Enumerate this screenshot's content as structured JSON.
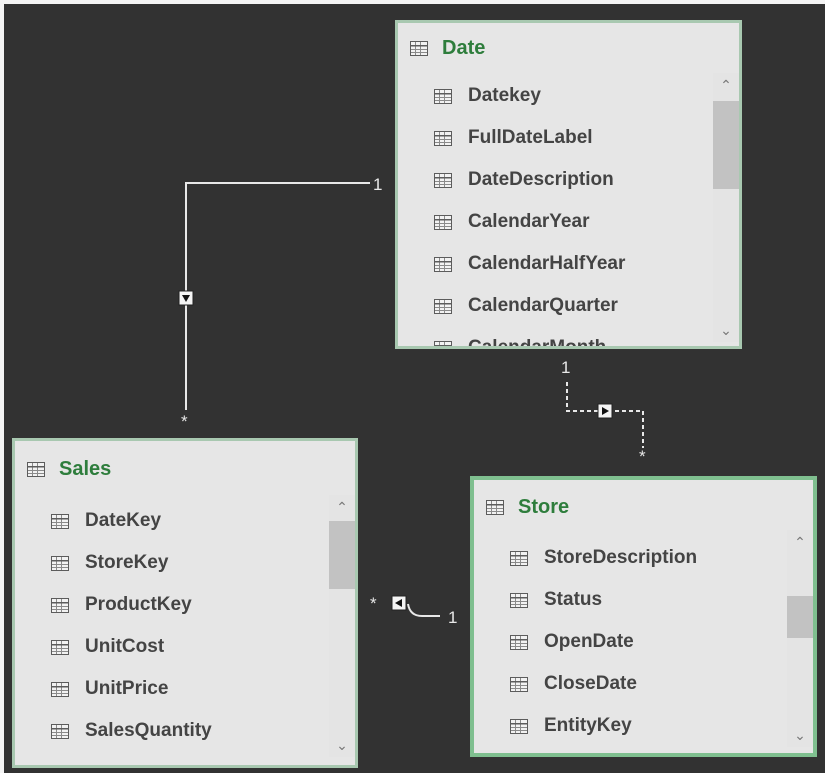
{
  "tables": {
    "date": {
      "title": "Date",
      "fields": [
        "Datekey",
        "FullDateLabel",
        "DateDescription",
        "CalendarYear",
        "CalendarHalfYear",
        "CalendarQuarter",
        "CalendarMonth"
      ]
    },
    "sales": {
      "title": "Sales",
      "fields": [
        "DateKey",
        "StoreKey",
        "ProductKey",
        "UnitCost",
        "UnitPrice",
        "SalesQuantity"
      ]
    },
    "store": {
      "title": "Store",
      "fields": [
        "StoreDescription",
        "Status",
        "OpenDate",
        "CloseDate",
        "EntityKey"
      ]
    }
  },
  "relationships": {
    "date_sales": {
      "one": "1",
      "many": "*"
    },
    "date_store": {
      "one": "1",
      "many": "*"
    },
    "store_sales": {
      "one": "1",
      "many": "*"
    }
  },
  "icons": {
    "table": "table-icon",
    "column": "column-icon",
    "scroll_up": "chevron-up-icon",
    "scroll_down": "chevron-down-icon",
    "filter_direction": "filter-arrow-icon"
  },
  "colors": {
    "canvas": "#323232",
    "card_bg": "#e6e6e6",
    "card_border": "#a8c8b0",
    "title_green": "#2e7d3c",
    "line": "#e8e8e8"
  }
}
